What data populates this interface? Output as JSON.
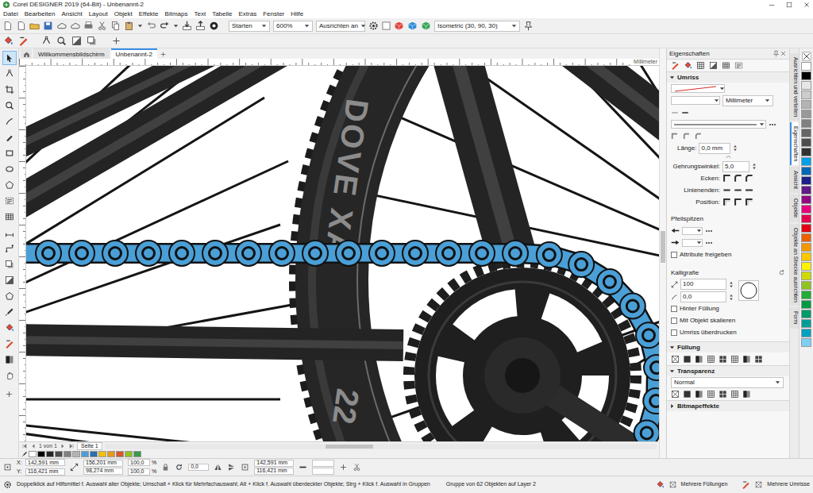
{
  "window": {
    "title": "Corel DESIGNER 2019 (64-Bit) - Unbenannt-2"
  },
  "menu": [
    "Datei",
    "Bearbeiten",
    "Ansicht",
    "Layout",
    "Objekt",
    "Effekte",
    "Bitmaps",
    "Text",
    "Tabelle",
    "Extras",
    "Fenster",
    "Hilfe"
  ],
  "toolbar": {
    "launch": "Starten",
    "zoom": "600%",
    "snap": "Ausrichten an",
    "projection": "Isometric (30, 90, 30)"
  },
  "tabs": [
    {
      "label": "Willkommensbildschirm",
      "selected": false
    },
    {
      "label": "Unbenannt-2",
      "selected": true
    }
  ],
  "ruler": {
    "unit": "Millimeter"
  },
  "tools": [
    {
      "selected": true
    },
    {
      "selected": false
    },
    {
      "selected": false
    },
    {
      "selected": false
    },
    {
      "selected": false
    },
    {
      "selected": false
    },
    {
      "selected": false
    },
    {
      "selected": false
    },
    {
      "selected": false
    },
    {
      "selected": false
    },
    {
      "selected": false
    },
    {
      "selected": false
    },
    {
      "selected": false
    },
    {
      "selected": false
    },
    {
      "selected": false
    },
    {
      "selected": false
    },
    {
      "selected": false
    },
    {
      "selected": false
    },
    {
      "selected": false
    },
    {
      "selected": false
    },
    {
      "selected": false
    }
  ],
  "canvas": {
    "tire_text": "DOVE XA",
    "tire_size": "22"
  },
  "page_nav": {
    "count": "1 von 1",
    "page_tab": "Seite 1"
  },
  "document_palette": [
    "#ffffff",
    "#000000",
    "#262626",
    "#4d4d4d",
    "#808080",
    "#b3b3b3",
    "#4a9fd6",
    "#2b6fae",
    "#f2c200",
    "#e89a1c",
    "#d9572b",
    "#8fc31f",
    "#3a9a4a"
  ],
  "docker": {
    "title": "Eigenschaften",
    "outline": {
      "header": "Umriss",
      "expanded": true,
      "unit": "Millimeter",
      "length_label": "Länge:",
      "length": "0,0 mm",
      "miter_label": "Gehrungswinkel:",
      "miter": "5,0",
      "corners_label": "Ecken:",
      "line_caps_label": "Linienenden:",
      "position_label": "Position:",
      "arrowheads_label": "Pfeilspitzen",
      "share_attributes": {
        "label": "Attribute freigeben",
        "checked": false
      },
      "calligraphy_label": "Kalligrafie",
      "stretch": "100",
      "angle": "0,0",
      "options": [
        {
          "label": "Hinter Füllung",
          "checked": false
        },
        {
          "label": "Mit Objekt skalieren",
          "checked": false
        },
        {
          "label": "Umriss überdrucken",
          "checked": false
        }
      ]
    },
    "fill": {
      "header": "Füllung",
      "expanded": true
    },
    "transparency": {
      "header": "Transparenz",
      "expanded": true,
      "mode": "Normal"
    },
    "bitmap_effects": {
      "header": "Bitmapeffekte",
      "expanded": false
    }
  },
  "vertical_tabs": [
    {
      "label": "Ausrichten und verteilen",
      "selected": false
    },
    {
      "label": "Eigenschaften",
      "selected": true
    },
    {
      "label": "Ansicht",
      "selected": false
    },
    {
      "label": "Objekte",
      "selected": false
    },
    {
      "label": "Objekte an Strecke ausrichten",
      "selected": false
    },
    {
      "label": "Form",
      "selected": false
    }
  ],
  "palette": [
    "#ffffff",
    "#000000",
    "#e6e6e6",
    "#cccccc",
    "#b3b3b3",
    "#999999",
    "#808080",
    "#666666",
    "#4d4d4d",
    "#333333",
    "#00a0e9",
    "#0068b7",
    "#1d2088",
    "#601986",
    "#920783",
    "#e4007f",
    "#e5004f",
    "#e60012",
    "#eb6100",
    "#f39800",
    "#fcc800",
    "#fff100",
    "#cfdb00",
    "#8fc31f",
    "#22ac38",
    "#009944",
    "#009b6b",
    "#009e96",
    "#00a0c1",
    "#7ecef4"
  ],
  "coords": {
    "x_label": "X:",
    "x": "142,591 mm",
    "y_label": "Y:",
    "y": "116,421 mm",
    "width": "156,201 mm",
    "height": "98,274 mm",
    "scale": [
      {
        "value": "100,0",
        "unit": "%"
      },
      {
        "value": "100,0",
        "unit": "%"
      }
    ],
    "rotation": "0,0",
    "center_x": "142,591 mm",
    "center_y": "116,421 mm"
  },
  "status": {
    "hint": "Doppelklick auf Hilfsmittel f. Auswahl aller Objekte; Umschalt + Klick für Mehrfachauswahl; Alt + Klick f. Auswahl überdeckter Objekte; Strg + Klick f. Auswahl in Gruppen",
    "selection": "Gruppe von 62 Objekten auf Layer 2",
    "fill": "Mehrere Füllungen",
    "outline": "Mehrere Umrisse"
  }
}
